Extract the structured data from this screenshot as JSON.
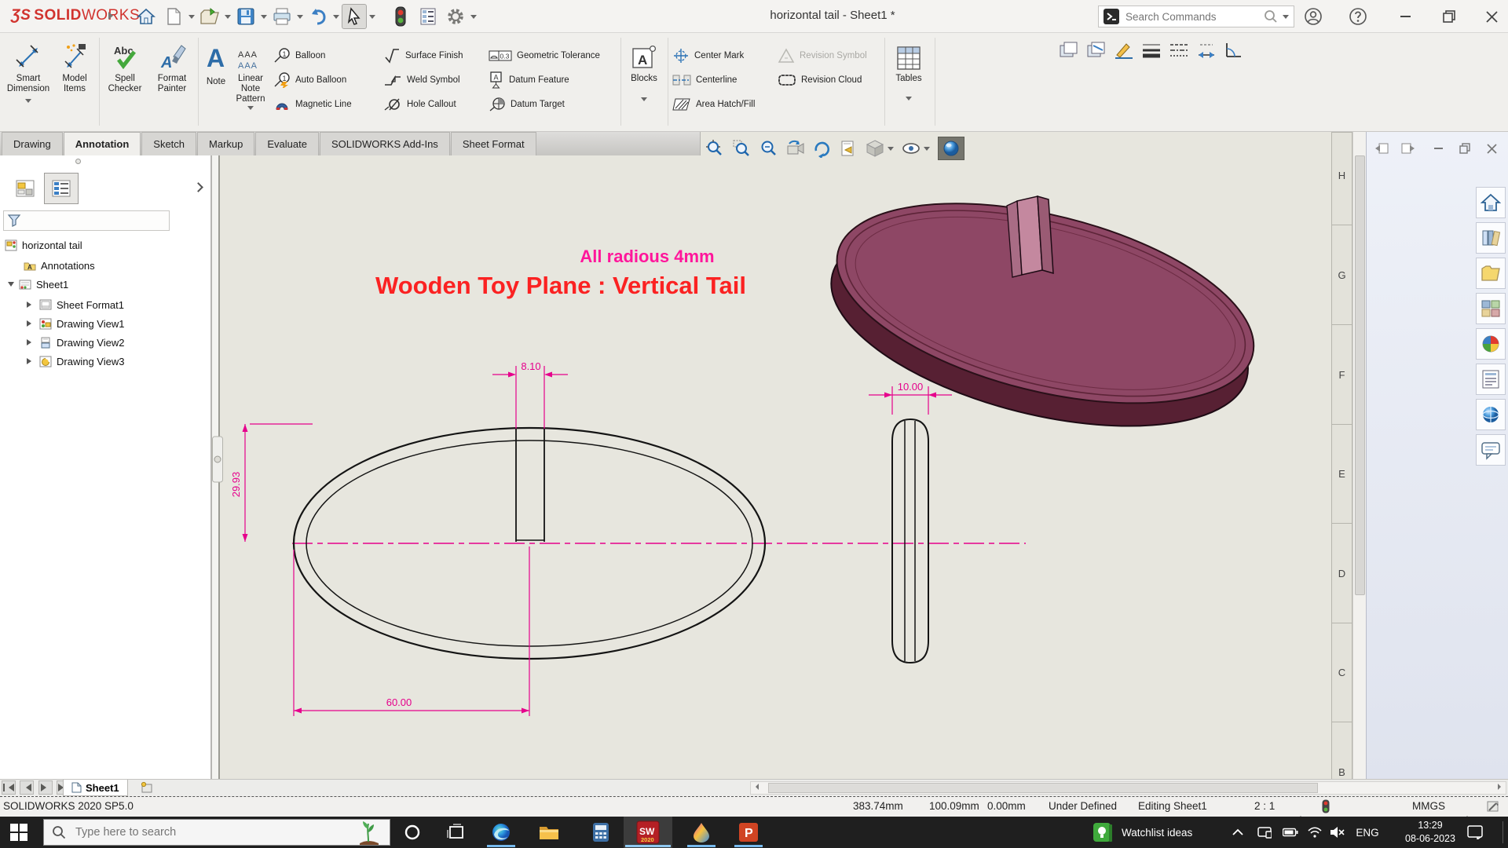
{
  "titlebar": {
    "logo_mark": "ƷS",
    "logo_solid": "SOLID",
    "logo_works": "WORKS",
    "title": "horizontal tail - Sheet1 *",
    "search_placeholder": "Search Commands"
  },
  "ribbon": {
    "smart_dimension_1": "Smart",
    "smart_dimension_2": "Dimension",
    "model_items_1": "Model",
    "model_items_2": "Items",
    "spell_checker_1": "Spell",
    "spell_checker_2": "Checker",
    "format_painter_1": "Format",
    "format_painter_2": "Painter",
    "note": "Note",
    "lnp_1": "Linear",
    "lnp_2": "Note",
    "lnp_3": "Pattern",
    "balloon": "Balloon",
    "auto_balloon": "Auto Balloon",
    "magnetic_line": "Magnetic Line",
    "surface_finish": "Surface Finish",
    "weld_symbol": "Weld Symbol",
    "hole_callout": "Hole Callout",
    "geometric_tolerance": "Geometric Tolerance",
    "datum_feature": "Datum Feature",
    "datum_target": "Datum Target",
    "blocks": "Blocks",
    "center_mark": "Center Mark",
    "centerline": "Centerline",
    "area_hatch": "Area Hatch/Fill",
    "revision_symbol": "Revision Symbol",
    "revision_cloud": "Revision Cloud",
    "tables": "Tables",
    "ic_abc": "Abc",
    "ic_aaa": "AAA",
    "ic_a": "A",
    "ic_03": "0.3",
    "ic_1": "1"
  },
  "tabs": [
    "Drawing",
    "Annotation",
    "Sketch",
    "Markup",
    "Evaluate",
    "SOLIDWORKS Add-Ins",
    "Sheet Format"
  ],
  "tree": {
    "root": "horizontal tail",
    "item_annotations": "Annotations",
    "item_sheet": "Sheet1",
    "child_0": "Sheet Format1",
    "child_1": "Drawing View1",
    "child_2": "Drawing View2",
    "child_3": "Drawing View3"
  },
  "drawing": {
    "note": "All radious 4mm",
    "title": "Wooden Toy Plane : Vertical Tail",
    "dim_slot": "8.10",
    "dim_height": "29.93",
    "dim_width": "60.00",
    "dim_thickness": "10.00",
    "accent_magenta": "#e6008c",
    "accent_red": "#fb2222",
    "accent_pink": "#ff169b"
  },
  "zones": [
    "H",
    "G",
    "F",
    "E",
    "D",
    "C",
    "B"
  ],
  "sheet_bar": {
    "tab": "Sheet1"
  },
  "statusbar": {
    "version": "SOLIDWORKS 2020 SP5.0",
    "x": "383.74mm",
    "y": "100.09mm",
    "z": "0.00mm",
    "state": "Under Defined",
    "editing": "Editing Sheet1",
    "scale": "2 : 1",
    "units": "MMGS"
  },
  "taskbar": {
    "search_placeholder": "Type here to search",
    "watchlist": "Watchlist ideas",
    "lang": "ENG",
    "time": "13:29",
    "date": "08-06-2023",
    "sw": "SW",
    "sw_year": "2020",
    "ppt": "P"
  }
}
